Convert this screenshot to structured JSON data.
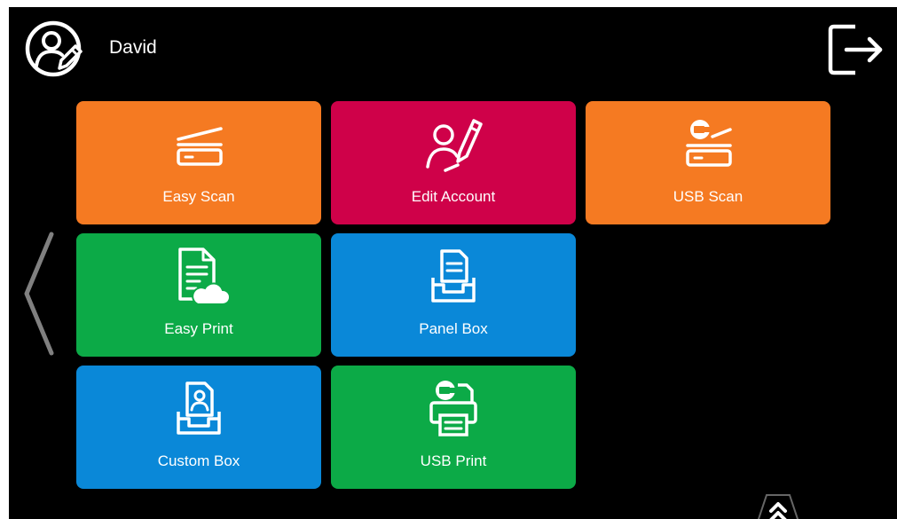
{
  "user": {
    "name": "David",
    "icon": "user-edit-icon"
  },
  "header": {
    "logout_icon": "logout-icon"
  },
  "tiles": [
    {
      "id": "easy-scan",
      "label": "Easy Scan",
      "color": "#F57A22",
      "icon": "scanner-icon"
    },
    {
      "id": "edit-account",
      "label": "Edit Account",
      "color": "#CF0149",
      "icon": "user-pen-icon"
    },
    {
      "id": "usb-scan",
      "label": "USB Scan",
      "color": "#F57A22",
      "icon": "usb-scanner-icon"
    },
    {
      "id": "easy-print",
      "label": "Easy Print",
      "color": "#0CAA47",
      "icon": "cloud-document-icon"
    },
    {
      "id": "panel-box",
      "label": "Panel Box",
      "color": "#0A88D8",
      "icon": "document-tray-icon"
    },
    {
      "id": "custom-box",
      "label": "Custom Box",
      "color": "#0A88D8",
      "icon": "user-document-tray-icon"
    },
    {
      "id": "usb-print",
      "label": "USB Print",
      "color": "#0CAA47",
      "icon": "usb-printer-icon"
    }
  ],
  "navigation": {
    "prev_icon": "chevron-left-icon",
    "expand_icon": "double-chevron-up-icon"
  },
  "pagination": {
    "pages": [
      {
        "icon": "star-icon",
        "active": false
      },
      {
        "icon": "dot-icon",
        "active": false
      },
      {
        "icon": "dot-icon",
        "active": true
      }
    ]
  }
}
